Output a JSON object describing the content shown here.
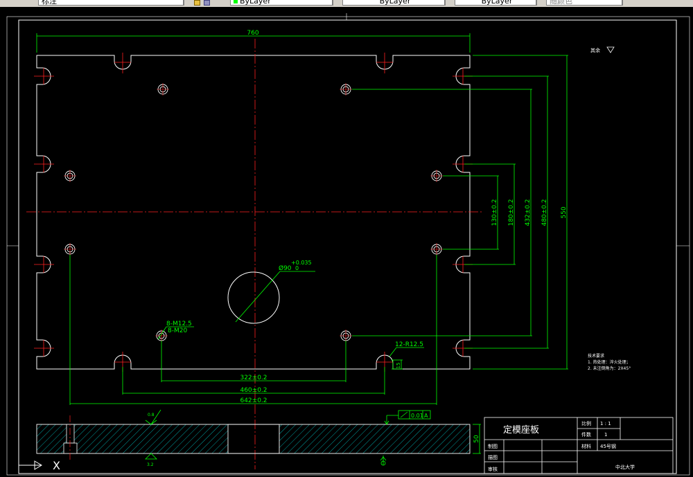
{
  "toolbar": {
    "style_value": "标注",
    "layer_value": "ByLayer",
    "linetype_value": "ByLayer",
    "lineweight_value": "ByLayer",
    "plotstyle_value": "随颜色"
  },
  "drawing": {
    "dims": {
      "overall_width": "760",
      "overall_height": "550",
      "v_130": "130±0.2",
      "v_180": "180±0.2",
      "v_432": "432±0.2",
      "v_480": "480±0.2",
      "h_322": "322±0.2",
      "h_460": "460±0.2",
      "h_642": "642±0.2",
      "hole_dia": "Ø90",
      "hole_tol_upper": "+0.035",
      "hole_tol_lower": "0",
      "thread_1": "8-M12.5",
      "thread_2": "8-M20",
      "slot_radius": "12-R12.5",
      "slot_depth": "15",
      "thickness": "50",
      "roughness_a": "0.8",
      "roughness_b": "3.2",
      "flatness": "0.01",
      "datum": "A"
    },
    "roughness_note": "其余",
    "tech_req": {
      "title": "技术要求",
      "line1": "1. 热处理：淬火处理；",
      "line2": "2. 未注倒角为：2X45°"
    }
  },
  "title_block": {
    "part_name": "定模座板",
    "scale_label": "比例",
    "scale_value": "1 : 1",
    "qty_label": "件数",
    "qty_value": "1",
    "material_label": "材料",
    "material_value": "45号钢",
    "drawn_label": "制图",
    "traced_label": "描图",
    "checked_label": "审核",
    "school": "中北大学"
  },
  "ucs": {
    "x_label": "X"
  }
}
